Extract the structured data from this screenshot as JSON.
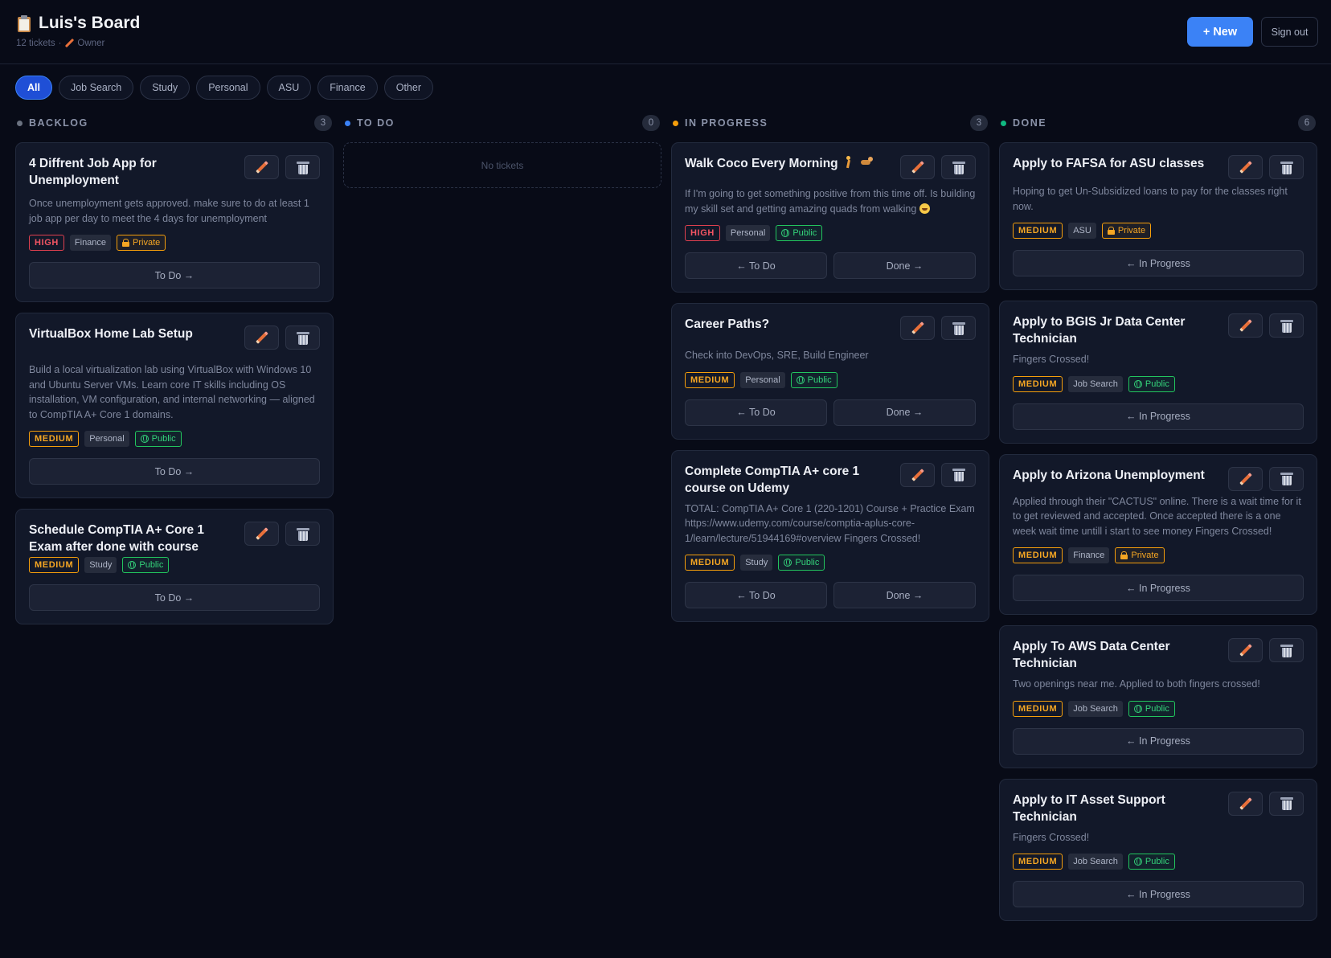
{
  "header": {
    "title": "Luis's Board",
    "ticket_count": "12 tickets",
    "separator": "·",
    "role": "Owner",
    "new_button": "+ New",
    "signout_button": "Sign out"
  },
  "filters": [
    "All",
    "Job Search",
    "Study",
    "Personal",
    "ASU",
    "Finance",
    "Other"
  ],
  "colors": {
    "backlog": "#6b7280",
    "todo": "#3b82f6",
    "in_progress": "#f59e0b",
    "done": "#10b981",
    "accent": "#3b82f6"
  },
  "columns": {
    "backlog": {
      "title": "BACKLOG",
      "count": "3",
      "cards": [
        {
          "title": "4 Diffrent Job App for Unemployment",
          "desc": "Once unemployment gets approved. make sure to do at least 1 job app per day to meet the 4 days for unemployment",
          "priority": "HIGH",
          "category": "Finance",
          "visibility": "Private",
          "move_next": "To Do →"
        },
        {
          "title": "VirtualBox Home Lab Setup",
          "desc": "Build a local virtualization lab using VirtualBox with Windows 10 and Ubuntu Server VMs. Learn core IT skills including OS installation, VM configuration, and internal networking — aligned to CompTIA A+ Core 1 domains.",
          "priority": "MEDIUM",
          "category": "Personal",
          "visibility": "Public",
          "move_next": "To Do →"
        },
        {
          "title": "Schedule CompTIA A+ Core 1 Exam after done with course",
          "priority": "MEDIUM",
          "category": "Study",
          "visibility": "Public",
          "move_next": "To Do →"
        }
      ]
    },
    "todo": {
      "title": "TO DO",
      "count": "0",
      "empty": "No tickets"
    },
    "in_progress": {
      "title": "IN PROGRESS",
      "count": "3",
      "cards": [
        {
          "title": "Walk Coco Every Morning",
          "desc": "If I'm going to get something positive from this time off. Is building my skill set and getting amazing quads from walking",
          "priority": "HIGH",
          "category": "Personal",
          "visibility": "Public",
          "move_prev": "← To Do",
          "move_next": "Done →"
        },
        {
          "title": "Career Paths?",
          "desc": "Check into DevOps, SRE, Build Engineer",
          "priority": "MEDIUM",
          "category": "Personal",
          "visibility": "Public",
          "move_prev": "← To Do",
          "move_next": "Done →"
        },
        {
          "title": "Complete CompTIA A+ core 1 course on Udemy",
          "desc": "TOTAL: CompTIA A+ Core 1 (220-1201) Course + Practice Exam https://www.udemy.com/course/comptia-aplus-core-1/learn/lecture/51944169#overview Fingers Crossed!",
          "priority": "MEDIUM",
          "category": "Study",
          "visibility": "Public",
          "move_prev": "← To Do",
          "move_next": "Done →"
        }
      ]
    },
    "done": {
      "title": "DONE",
      "count": "6",
      "cards": [
        {
          "title": "Apply to FAFSA for ASU classes",
          "desc": "Hoping to get Un-Subsidized loans to pay for the classes right now.",
          "priority": "MEDIUM",
          "category": "ASU",
          "visibility": "Private",
          "move_prev": "← In Progress"
        },
        {
          "title": "Apply to BGIS Jr Data Center Technician",
          "desc": "Fingers Crossed!",
          "priority": "MEDIUM",
          "category": "Job Search",
          "visibility": "Public",
          "move_prev": "← In Progress"
        },
        {
          "title": "Apply to Arizona Unemployment",
          "desc": "Applied through their \"CACTUS\" online. There is a wait time for it to get reviewed and accepted. Once accepted there is a one week wait time untill i start to see money Fingers Crossed!",
          "priority": "MEDIUM",
          "category": "Finance",
          "visibility": "Private",
          "move_prev": "← In Progress"
        },
        {
          "title": "Apply To AWS Data Center Technician",
          "desc": "Two openings near me. Applied to both fingers crossed!",
          "priority": "MEDIUM",
          "category": "Job Search",
          "visibility": "Public",
          "move_prev": "← In Progress"
        },
        {
          "title": "Apply to IT Asset Support Technician",
          "desc": "Fingers Crossed!",
          "priority": "MEDIUM",
          "category": "Job Search",
          "visibility": "Public",
          "move_prev": "← In Progress"
        }
      ]
    }
  }
}
